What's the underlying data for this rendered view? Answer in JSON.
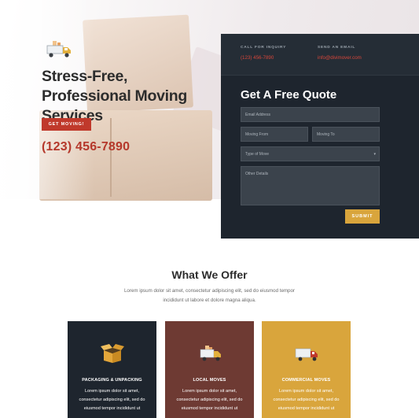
{
  "hero": {
    "title": "Stress-Free, Professional Moving Services",
    "cta_label": "GET MOVING!",
    "phone": "(123) 456-7890",
    "logo_icon": "truck-icon"
  },
  "quote": {
    "inquiry_label": "CALL FOR INQUIRY",
    "inquiry_value": "(123) 456-7890",
    "email_label": "SEND AN EMAIL",
    "email_value": "info@divimover.com",
    "title": "Get A Free Quote",
    "fields": {
      "email": "Email Address",
      "moving_from": "Moving From",
      "moving_to": "Moving To",
      "type_of_move": "Type of Move",
      "other_details": "Other Details"
    },
    "submit_label": "SUBMIT"
  },
  "offer": {
    "title": "What We Offer",
    "description": "Lorem ipsum dolor sit amet, consectetur adipiscing elit, sed do eiusmod tempor incididunt ut labore et dolore magna aliqua.",
    "cards": [
      {
        "title": "PACKAGING & UNPACKING",
        "body": "Lorem ipsum dolor sit amet, consectetur adipiscing elit, sed do eiusmod tempor incididunt ut",
        "icon": "box-icon"
      },
      {
        "title": "LOCAL MOVES",
        "body": "Lorem ipsum dolor sit amet, consectetur adipiscing elit, sed do eiusmod tempor incididunt ut",
        "icon": "truck-icon"
      },
      {
        "title": "COMMERCIAL MOVES",
        "body": "Lorem ipsum dolor sit amet, consectetur adipiscing elit, sed do eiusmod tempor incididunt ut",
        "icon": "truck-icon"
      }
    ]
  },
  "colors": {
    "accent_red": "#c0392b",
    "dark_panel": "#1e252e",
    "brown": "#6e3a33",
    "gold": "#d9a53c"
  }
}
